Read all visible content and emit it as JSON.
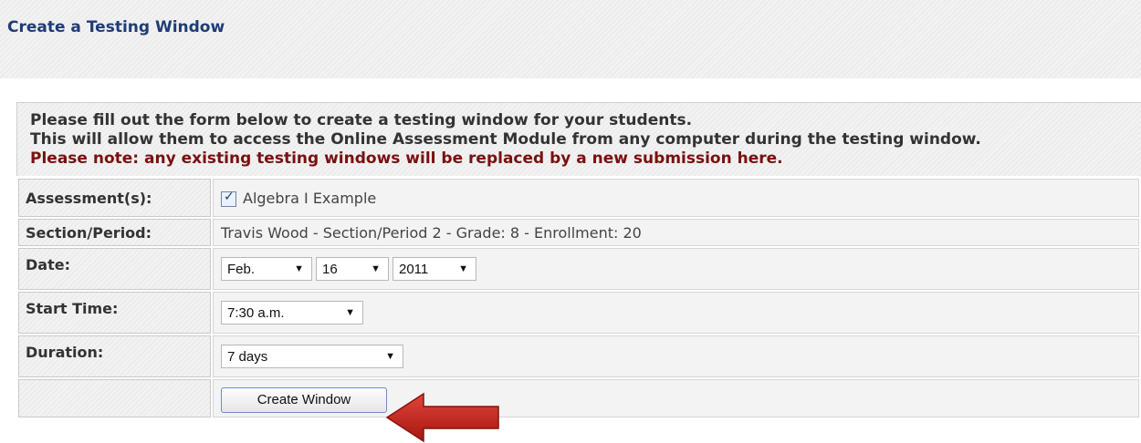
{
  "page": {
    "title": "Create a Testing Window"
  },
  "notice": {
    "line1": "Please fill out the form below to create a testing window for your students.",
    "line2": "This will allow them to access the Online Assessment Module from any computer during the testing window.",
    "line3": "Please note: any existing testing windows will be replaced by a new submission here."
  },
  "form": {
    "assessment": {
      "label": "Assessment(s):",
      "checked": true,
      "option": "Algebra I Example"
    },
    "section": {
      "label": "Section/Period:",
      "value": "Travis Wood - Section/Period 2 - Grade: 8 - Enrollment: 20"
    },
    "date": {
      "label": "Date:",
      "month": "Feb.",
      "day": "16",
      "year": "2011"
    },
    "start_time": {
      "label": "Start Time:",
      "value": "7:30 a.m."
    },
    "duration": {
      "label": "Duration:",
      "value": "7 days"
    },
    "submit_label": "Create Window"
  },
  "colors": {
    "title": "#1f3d73",
    "warning": "#7a1010",
    "arrow": "#c0241d"
  },
  "icons": {
    "dropdown": "chevron-down-icon",
    "pointer": "red-arrow-icon"
  }
}
